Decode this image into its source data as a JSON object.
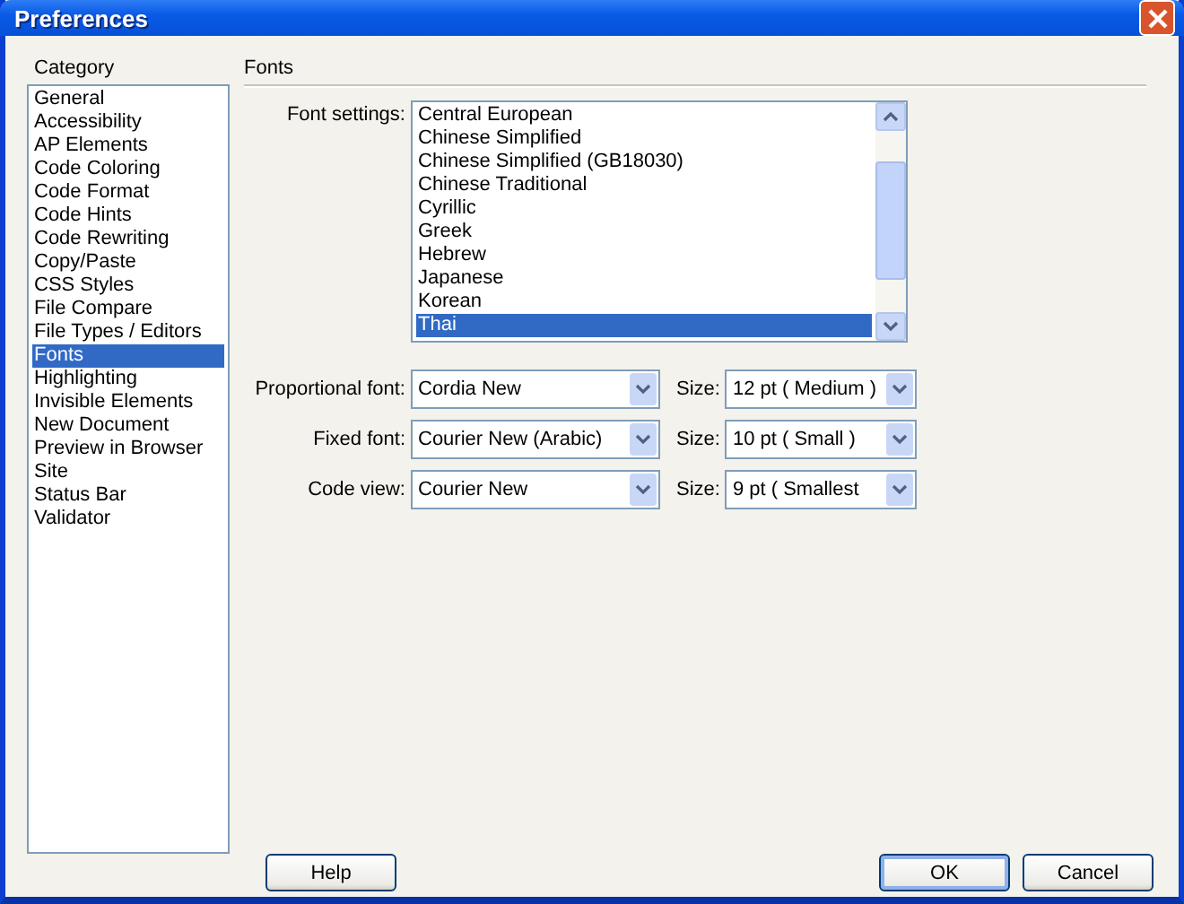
{
  "window": {
    "title": "Preferences"
  },
  "category": {
    "label": "Category",
    "items": [
      {
        "label": "General",
        "selected": false
      },
      {
        "label": "Accessibility",
        "selected": false
      },
      {
        "label": "AP Elements",
        "selected": false
      },
      {
        "label": "Code Coloring",
        "selected": false
      },
      {
        "label": "Code Format",
        "selected": false
      },
      {
        "label": "Code Hints",
        "selected": false
      },
      {
        "label": "Code Rewriting",
        "selected": false
      },
      {
        "label": "Copy/Paste",
        "selected": false
      },
      {
        "label": "CSS Styles",
        "selected": false
      },
      {
        "label": "File Compare",
        "selected": false
      },
      {
        "label": "File Types / Editors",
        "selected": false
      },
      {
        "label": "Fonts",
        "selected": true
      },
      {
        "label": "Highlighting",
        "selected": false
      },
      {
        "label": "Invisible Elements",
        "selected": false
      },
      {
        "label": "New Document",
        "selected": false
      },
      {
        "label": "Preview in Browser",
        "selected": false
      },
      {
        "label": "Site",
        "selected": false
      },
      {
        "label": "Status Bar",
        "selected": false
      },
      {
        "label": "Validator",
        "selected": false
      }
    ]
  },
  "section_title": "Fonts",
  "font_settings": {
    "label": "Font settings:",
    "items": [
      {
        "label": "Central European",
        "selected": false
      },
      {
        "label": "Chinese Simplified",
        "selected": false
      },
      {
        "label": "Chinese Simplified (GB18030)",
        "selected": false
      },
      {
        "label": "Chinese Traditional",
        "selected": false
      },
      {
        "label": "Cyrillic",
        "selected": false
      },
      {
        "label": "Greek",
        "selected": false
      },
      {
        "label": "Hebrew",
        "selected": false
      },
      {
        "label": "Japanese",
        "selected": false
      },
      {
        "label": "Korean",
        "selected": false
      },
      {
        "label": "Thai",
        "selected": true
      }
    ]
  },
  "font_rows": [
    {
      "label": "Proportional font:",
      "value": "Cordia New",
      "size_label": "Size:",
      "size_value": "12 pt  ( Medium )"
    },
    {
      "label": "Fixed font:",
      "value": "Courier New (Arabic)",
      "size_label": "Size:",
      "size_value": "10 pt  ( Small )"
    },
    {
      "label": "Code view:",
      "value": "Courier New",
      "size_label": "Size:",
      "size_value": "9 pt    ( Smallest"
    }
  ],
  "buttons": [
    {
      "label": "Help",
      "default": false
    },
    {
      "label": "OK",
      "default": true
    },
    {
      "label": "Cancel",
      "default": false
    }
  ]
}
